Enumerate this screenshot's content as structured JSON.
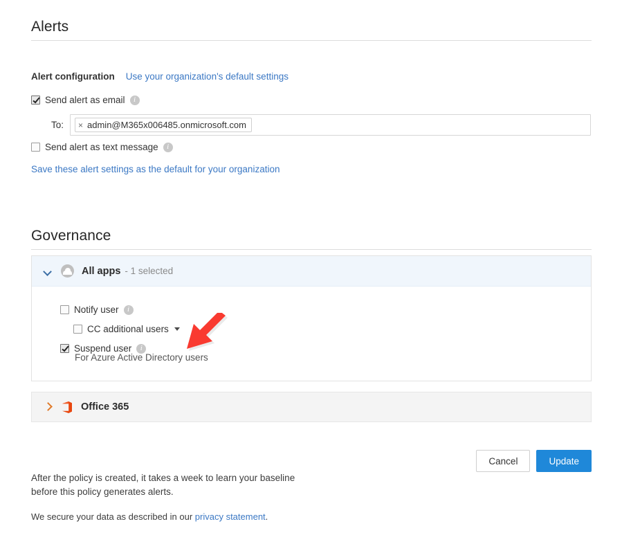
{
  "alerts": {
    "title": "Alerts",
    "config_label": "Alert configuration",
    "config_link": "Use your organization's default settings",
    "send_email_label": "Send alert as email",
    "send_email_checked": true,
    "to_label": "To:",
    "recipient_chip": "admin@M365x006485.onmicrosoft.com",
    "chip_remove_icon": "×",
    "send_text_label": "Send alert as text message",
    "send_text_checked": false,
    "save_default_link": "Save these alert settings as the default for your organization"
  },
  "governance": {
    "title": "Governance",
    "all_apps": {
      "name": "All apps",
      "count": "- 1 selected",
      "expanded": true,
      "notify_user_label": "Notify user",
      "notify_user_checked": false,
      "cc_users_label": "CC additional users",
      "cc_users_checked": false,
      "suspend_user_label": "Suspend user",
      "suspend_user_checked": true,
      "suspend_user_sub": "For Azure Active Directory users"
    },
    "office365": {
      "name": "Office 365",
      "expanded": false
    }
  },
  "actions": {
    "cancel_label": "Cancel",
    "update_label": "Update"
  },
  "footer": {
    "note": "After the policy is created, it takes a week to learn your baseline before this policy generates alerts.",
    "secure_prefix": "We secure your data as described in our ",
    "privacy_link": "privacy statement",
    "secure_suffix": "."
  },
  "colors": {
    "link": "#3b78c4",
    "primary_button": "#1f88d9",
    "panel_header": "#f0f6fc",
    "office_icon": "#e8470f",
    "annotation_arrow": "#f93a30"
  }
}
